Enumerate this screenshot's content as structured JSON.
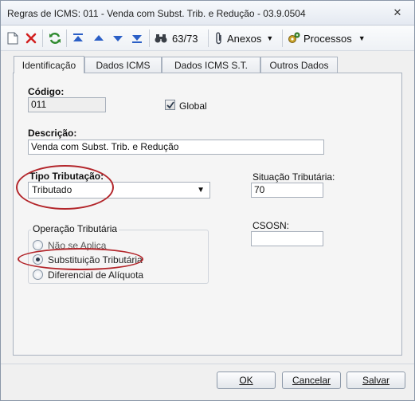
{
  "window": {
    "title": "Regras de ICMS: 011 - Venda com Subst. Trib. e Redução - 03.9.0504",
    "close_glyph": "✕"
  },
  "toolbar": {
    "counter": "63/73",
    "attachments_label": "Anexos",
    "processes_label": "Processos"
  },
  "tabs": [
    "Identificação",
    "Dados ICMS",
    "Dados ICMS S.T.",
    "Outros Dados"
  ],
  "form": {
    "codigo_label": "Código:",
    "codigo_value": "011",
    "global_label": "Global",
    "global_checked": true,
    "descricao_label": "Descrição:",
    "descricao_value": "Venda com Subst. Trib. e Redução",
    "tipo_tributacao_label": "Tipo Tributação:",
    "tipo_tributacao_value": "Tributado",
    "situacao_tributaria_label": "Situação Tributária:",
    "situacao_tributaria_value": "70",
    "operacao_group_title": "Operação Tributária",
    "operacao_options": [
      "Não se Aplica",
      "Substituição Tributária",
      "Diferencial de Alíquota"
    ],
    "operacao_selected": "Substituição Tributária",
    "csosn_label": "CSOSN:",
    "csosn_value": ""
  },
  "buttons": {
    "ok": "OK",
    "cancel": "Cancelar",
    "save": "Salvar"
  },
  "colors": {
    "highlight_ellipse": "#b3262b",
    "refresh_icon": "#2f8a2f",
    "delete_icon": "#d22020",
    "nav_icon": "#2b5fc6"
  }
}
